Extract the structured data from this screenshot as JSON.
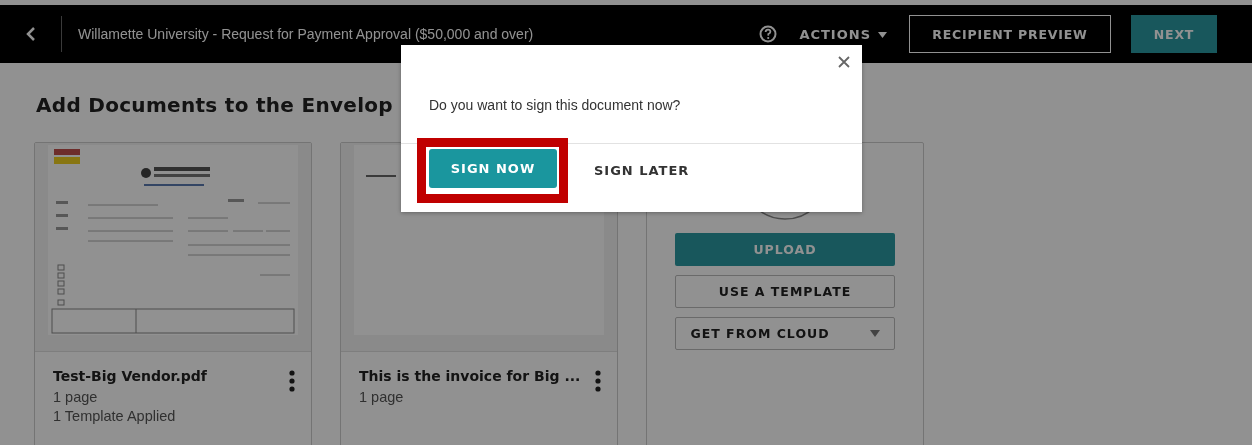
{
  "top_bar": {
    "title": "Willamette University - Request for Payment Approval ($50,000 and over)",
    "actions_label": "ACTIONS",
    "buttons": [
      {
        "label": "RECIPIENT PREVIEW",
        "kind": "outline"
      },
      {
        "label": "NEXT",
        "kind": "primary"
      }
    ]
  },
  "heading": "Add Documents to the Envelop",
  "documents": [
    {
      "name": "Test-Big Vendor.pdf",
      "pages": "1 page",
      "note": "1 Template Applied",
      "kind": "form"
    },
    {
      "name": "This is the invoice for Big ...",
      "pages": "1 page",
      "kind": "blank"
    }
  ],
  "add_panel": {
    "buttons": [
      {
        "label": "UPLOAD",
        "kind": "primary"
      },
      {
        "label": "USE A TEMPLATE",
        "kind": "outline"
      },
      {
        "label": "GET FROM CLOUD",
        "kind": "dropdown"
      }
    ]
  },
  "dialog": {
    "message": "Do you want to sign this document now?",
    "buttons": [
      {
        "label": "SIGN NOW",
        "kind": "primary",
        "highlighted": true
      },
      {
        "label": "SIGN LATER",
        "kind": "text",
        "highlighted": false
      }
    ]
  }
}
